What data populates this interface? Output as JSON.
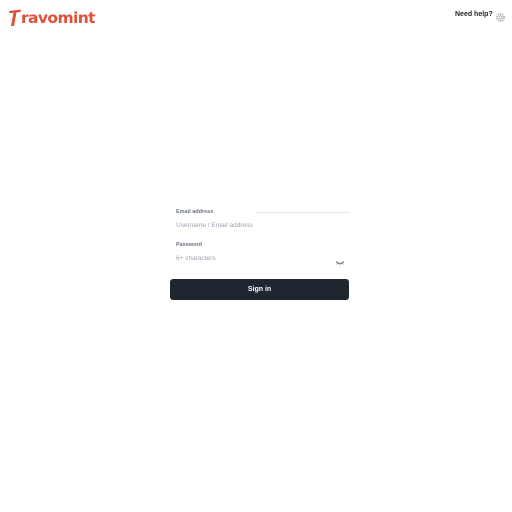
{
  "brand": {
    "logo_text": "ravomint",
    "logo_letter": "T",
    "color": "#e0513a"
  },
  "header": {
    "help_label": "Need help?",
    "settings_icon": "gear-icon"
  },
  "form": {
    "email_label": "Email address",
    "email_placeholder": "Username / Email address",
    "password_label": "Password",
    "password_placeholder": "6+ characters",
    "toggle_icon": "eye-closed-icon",
    "submit_label": "Sign in",
    "submit_color": "#1f2630"
  }
}
